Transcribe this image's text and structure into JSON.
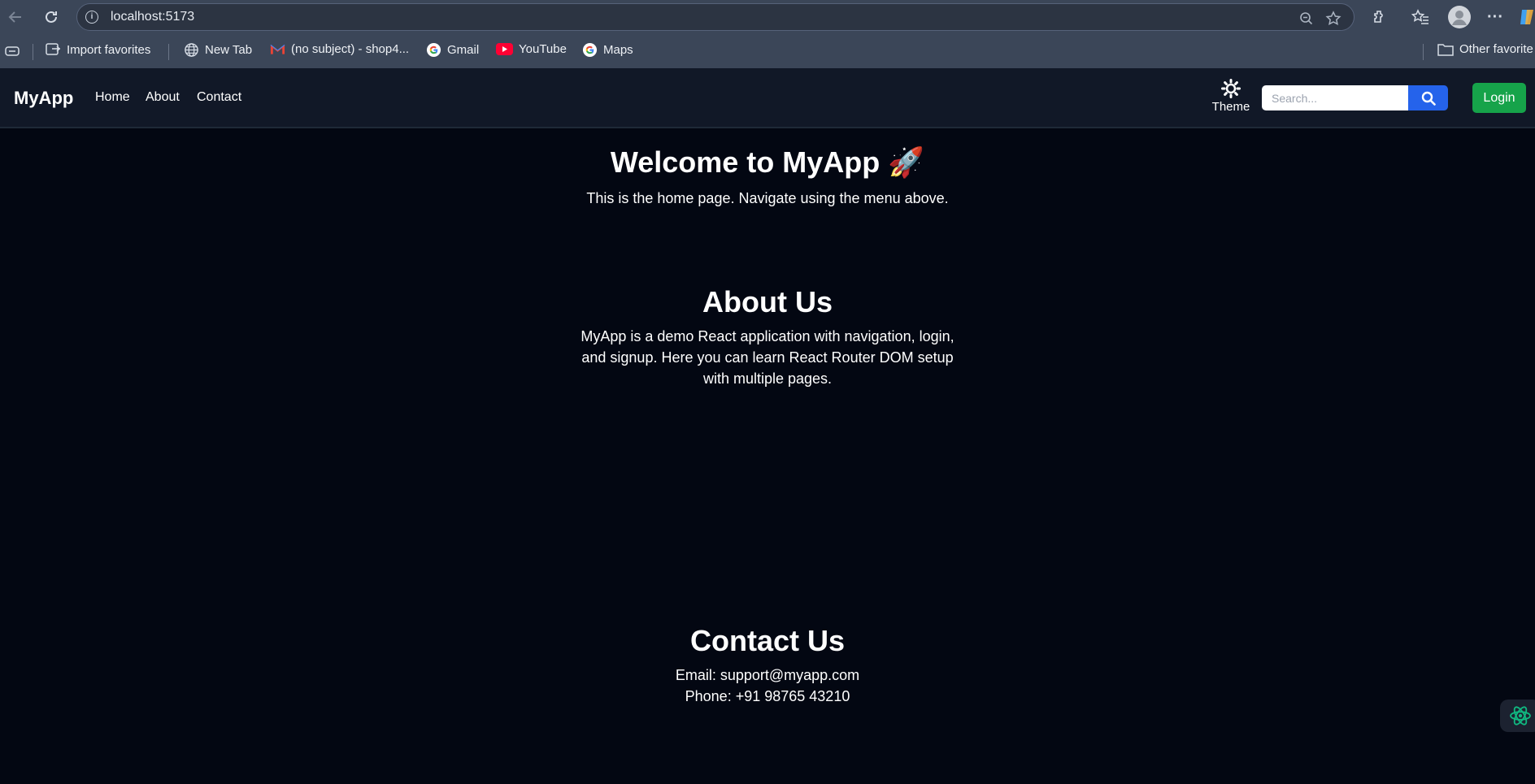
{
  "browser": {
    "url": "localhost:5173",
    "bookmarks": [
      {
        "label": "Import favorites",
        "icon": "import-icon"
      },
      {
        "label": "New Tab",
        "icon": "globe-icon"
      },
      {
        "label": "(no subject) - shop4...",
        "icon": "gmail-icon"
      },
      {
        "label": "Gmail",
        "icon": "google-icon"
      },
      {
        "label": "YouTube",
        "icon": "youtube-icon"
      },
      {
        "label": "Maps",
        "icon": "google-icon"
      }
    ],
    "other_favorites": "Other favorite"
  },
  "navbar": {
    "brand": "MyApp",
    "links": [
      "Home",
      "About",
      "Contact"
    ],
    "theme_label": "Theme",
    "search_placeholder": "Search...",
    "login_label": "Login"
  },
  "home": {
    "title": "Welcome to MyApp 🚀",
    "text": "This is the home page. Navigate using the menu above."
  },
  "about": {
    "title": "About Us",
    "text": "MyApp is a demo React application with navigation, login, and signup. Here you can learn React Router DOM setup with multiple pages."
  },
  "contact": {
    "title": "Contact Us",
    "email": "Email: support@myapp.com",
    "phone": "Phone: +91 98765 43210"
  },
  "colors": {
    "page_bg": "#030712",
    "navbar_bg": "#111827",
    "search_button": "#2563eb",
    "login_button": "#16a34a"
  }
}
